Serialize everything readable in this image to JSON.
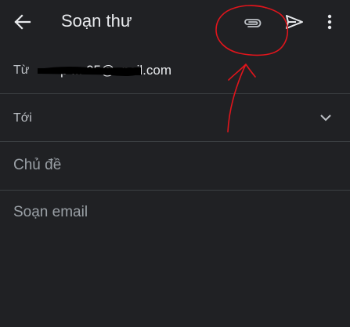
{
  "toolbar": {
    "title": "Soạn thư",
    "icons": {
      "back": "arrow-back-icon",
      "attach": "paperclip-icon",
      "send": "send-icon",
      "more": "more-vert-icon"
    }
  },
  "compose": {
    "from_label": "Từ",
    "from_value_visible": "p   ... 05@ .nail.com",
    "to_label": "Tới",
    "subject_placeholder": "Chủ đề",
    "body_placeholder": "Soạn email"
  },
  "colors": {
    "background": "#202124",
    "divider": "#3c4043",
    "text_primary": "#e8eaed",
    "text_secondary": "#9aa0a6",
    "annotation": "#e0151c"
  }
}
